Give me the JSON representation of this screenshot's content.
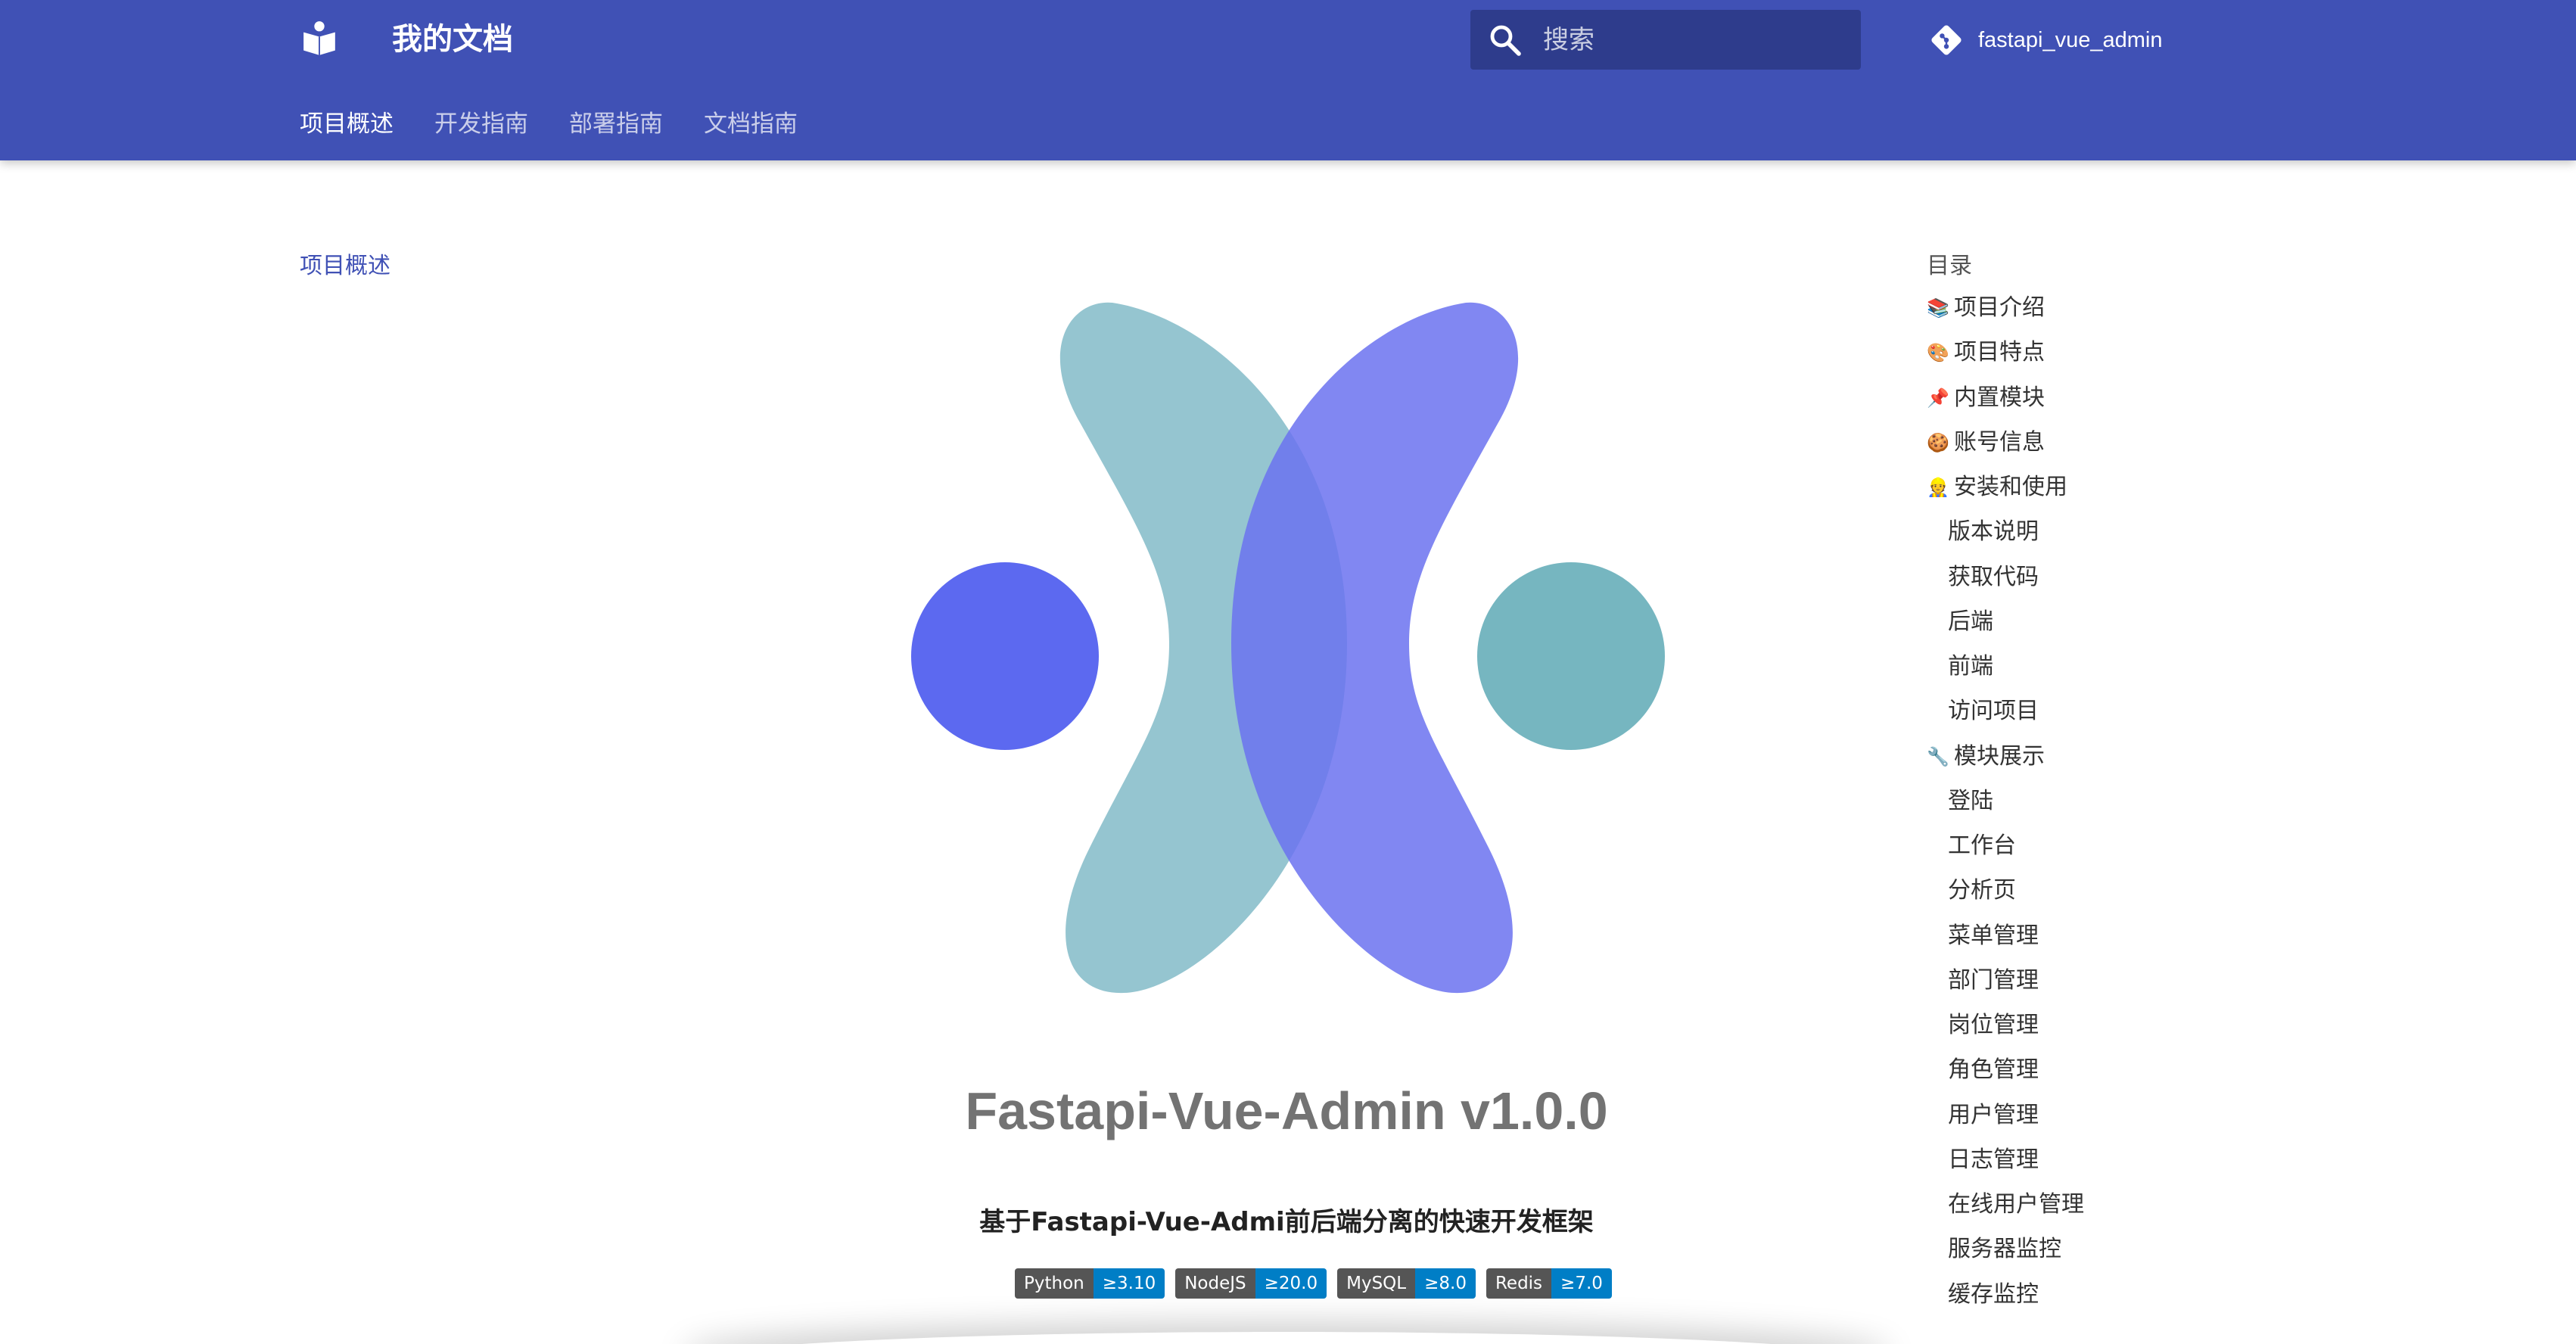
{
  "header": {
    "site_title": "我的文档",
    "logo_icon": "book-reader-icon",
    "search": {
      "placeholder": "搜索",
      "icon": "search-icon"
    },
    "repo": {
      "name": "fastapi_vue_admin",
      "icon": "git-icon"
    },
    "tabs": [
      {
        "label": "项目概述",
        "active": true
      },
      {
        "label": "开发指南",
        "active": false
      },
      {
        "label": "部署指南",
        "active": false
      },
      {
        "label": "文档指南",
        "active": false
      }
    ],
    "color": "#4051b5"
  },
  "left_nav": {
    "items": [
      {
        "label": "项目概述"
      }
    ]
  },
  "main": {
    "title": "Fastapi-Vue-Admin v1.0.0",
    "subtitle": "基于Fastapi-Vue-Admi前后端分离的快速开发框架",
    "badges": [
      {
        "label": "Python",
        "value": "≥3.10"
      },
      {
        "label": "NodeJS",
        "value": "≥20.0"
      },
      {
        "label": "MySQL",
        "value": "≥8.0"
      },
      {
        "label": "Redis",
        "value": "≥7.0"
      }
    ],
    "logo_colors": {
      "left_blob": "#86bdc9",
      "right_blob": "#6b72f0",
      "left_dot": "#5c69f0",
      "right_dot": "#76b6c0"
    }
  },
  "toc": {
    "title": "目录",
    "items": [
      {
        "emoji": "📚",
        "label": "项目介绍",
        "level": 1
      },
      {
        "emoji": "🎨",
        "label": "项目特点",
        "level": 1
      },
      {
        "emoji": "📌",
        "label": "内置模块",
        "level": 1
      },
      {
        "emoji": "🍪",
        "label": "账号信息",
        "level": 1
      },
      {
        "emoji": "👷",
        "label": "安装和使用",
        "level": 1
      },
      {
        "emoji": "",
        "label": "版本说明",
        "level": 2
      },
      {
        "emoji": "",
        "label": "获取代码",
        "level": 2
      },
      {
        "emoji": "",
        "label": "后端",
        "level": 2
      },
      {
        "emoji": "",
        "label": "前端",
        "level": 2
      },
      {
        "emoji": "",
        "label": "访问项目",
        "level": 2
      },
      {
        "emoji": "🔧",
        "label": "模块展示",
        "level": 1
      },
      {
        "emoji": "",
        "label": "登陆",
        "level": 2
      },
      {
        "emoji": "",
        "label": "工作台",
        "level": 2
      },
      {
        "emoji": "",
        "label": "分析页",
        "level": 2
      },
      {
        "emoji": "",
        "label": "菜单管理",
        "level": 2
      },
      {
        "emoji": "",
        "label": "部门管理",
        "level": 2
      },
      {
        "emoji": "",
        "label": "岗位管理",
        "level": 2
      },
      {
        "emoji": "",
        "label": "角色管理",
        "level": 2
      },
      {
        "emoji": "",
        "label": "用户管理",
        "level": 2
      },
      {
        "emoji": "",
        "label": "日志管理",
        "level": 2
      },
      {
        "emoji": "",
        "label": "在线用户管理",
        "level": 2
      },
      {
        "emoji": "",
        "label": "服务器监控",
        "level": 2
      },
      {
        "emoji": "",
        "label": "缓存监控",
        "level": 2
      }
    ]
  }
}
